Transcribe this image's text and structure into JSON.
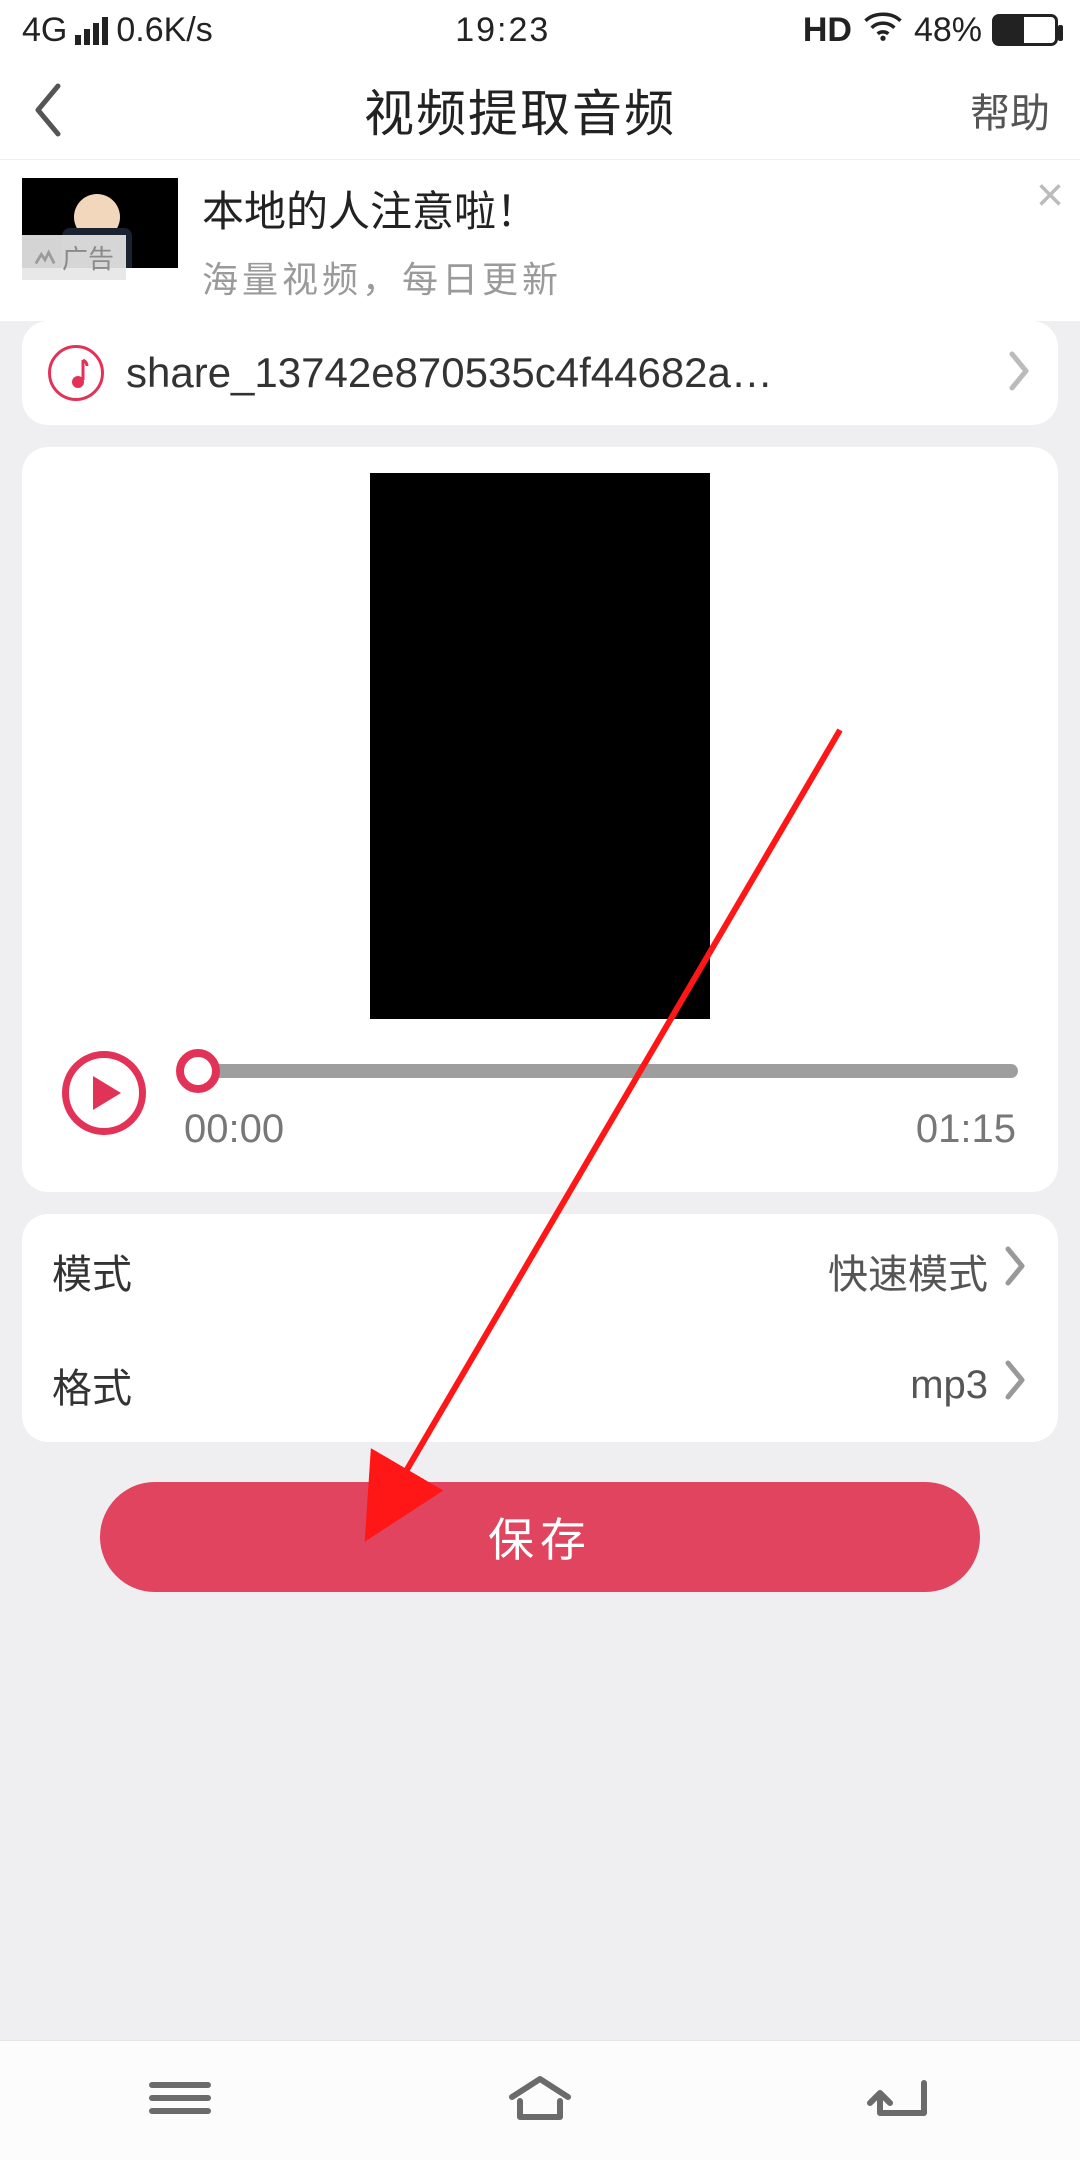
{
  "status": {
    "network": "4G",
    "speed": "0.6K/s",
    "time": "19:23",
    "hd": "HD",
    "battery_pct": "48%"
  },
  "header": {
    "title": "视频提取音频",
    "help": "帮助"
  },
  "ad": {
    "tag": "广告",
    "title": "本地的人注意啦！",
    "subtitle": "海量视频，每日更新"
  },
  "file": {
    "name": "share_13742e870535c4f44682a…"
  },
  "player": {
    "current": "00:00",
    "total": "01:15"
  },
  "options": {
    "mode_label": "模式",
    "mode_value": "快速模式",
    "format_label": "格式",
    "format_value": "mp3"
  },
  "actions": {
    "save": "保存"
  }
}
